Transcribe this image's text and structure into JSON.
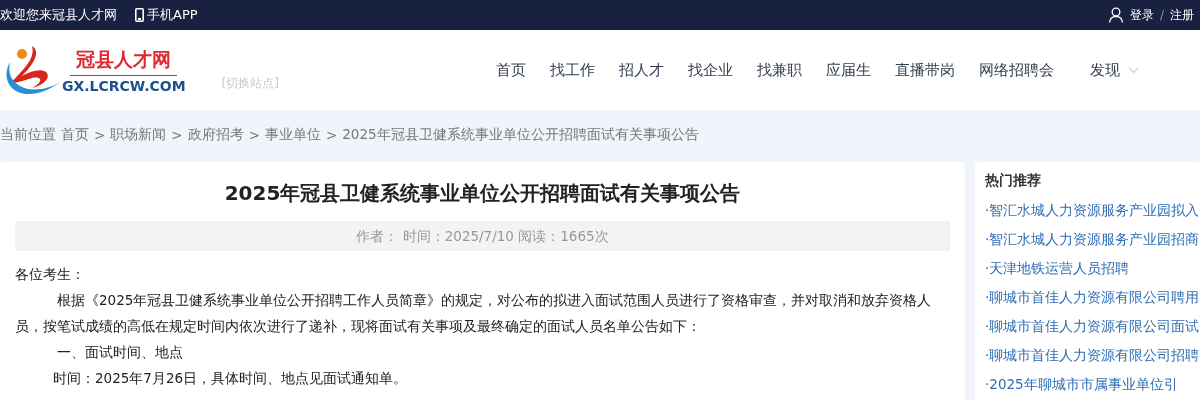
{
  "top_bar": {
    "welcome": "欢迎您来冠县人才网",
    "app_link": "手机APP",
    "login": "登录",
    "separator": "/",
    "register": "注册"
  },
  "header": {
    "logo_title": "冠县人才网",
    "logo_domain": "GX.LCRCW.COM",
    "switch_site": "[切换站点]",
    "nav": [
      {
        "label": "首页"
      },
      {
        "label": "找工作"
      },
      {
        "label": "招人才"
      },
      {
        "label": "找企业"
      },
      {
        "label": "找兼职"
      },
      {
        "label": "应届生"
      },
      {
        "label": "直播带岗"
      },
      {
        "label": "网络招聘会"
      },
      {
        "label": "发现",
        "dropdown": true
      }
    ]
  },
  "breadcrumb": {
    "prefix": "当前位置",
    "items": [
      "首页",
      "职场新闻",
      "政府招考",
      "事业单位",
      "2025年冠县卫健系统事业单位公开招聘面试有关事项公告"
    ],
    "separator": ">"
  },
  "article": {
    "title": "2025年冠县卫健系统事业单位公开招聘面试有关事项公告",
    "meta": "作者：  时间：2025/7/10 阅读：1665次",
    "paragraphs": [
      {
        "kind": "plain",
        "text": "各位考生："
      },
      {
        "kind": "indent",
        "text": "根据《2025年冠县卫健系统事业单位公开招聘工作人员简章》的规定，对公布的拟进入面试范围人员进行了资格审查，并对取消和放弃资格人员，按笔试成绩的高低在规定时间内依次进行了递补，现将面试有关事项及最终确定的面试人员名单公告如下："
      },
      {
        "kind": "indent",
        "text": "一、面试时间、地点"
      },
      {
        "kind": "half",
        "text": "时间：2025年7月26日，具体时间、地点见面试通知单。"
      }
    ]
  },
  "sidebar": {
    "title": "热门推荐",
    "items": [
      "·智汇水城人力资源服务产业园拟入",
      "·智汇水城人力资源服务产业园招商",
      "·天津地铁运营人员招聘",
      "·聊城市首佳人力资源有限公司聘用",
      "·聊城市首佳人力资源有限公司面试",
      "·聊城市首佳人力资源有限公司招聘",
      "·2025年聊城市市属事业单位引"
    ]
  }
}
